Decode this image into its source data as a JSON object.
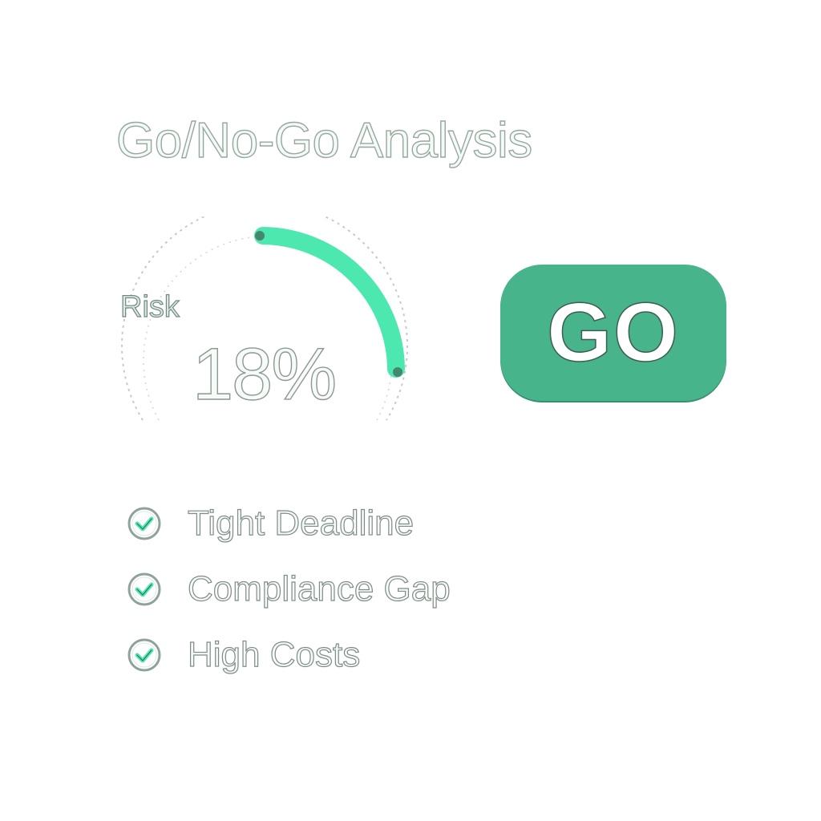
{
  "header": {
    "title": "Go/No-Go Analysis"
  },
  "risk_gauge": {
    "label": "Risk",
    "value_text": "18%",
    "value": 18,
    "accent_color": "#4de8b0",
    "track_color": "#d0d0d0"
  },
  "decision": {
    "label": "GO",
    "color": "#48b48c"
  },
  "factors": [
    {
      "label": "Tight Deadline",
      "icon": "check-circle-icon"
    },
    {
      "label": "Compliance Gap",
      "icon": "check-circle-icon"
    },
    {
      "label": "High Costs",
      "icon": "check-circle-icon"
    }
  ]
}
